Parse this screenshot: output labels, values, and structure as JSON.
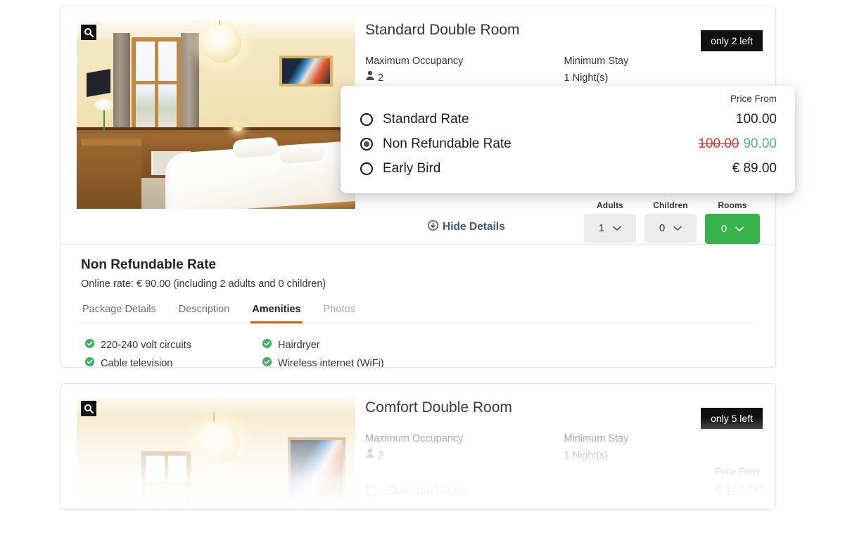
{
  "cards": [
    {
      "title": "Standard Double Room",
      "stock_badge": "only 2 left",
      "occupancy_label": "Maximum Occupancy",
      "occupancy_value": "2",
      "stay_label": "Minimum Stay",
      "stay_value": "1 Night(s)",
      "zoom_icon": "magnifier-icon",
      "hide_details": "Hide Details",
      "hide_details_icon": "circle-arrow-down-icon",
      "selectors": [
        {
          "caption": "Adults",
          "value": "1",
          "accent": false
        },
        {
          "caption": "Children",
          "value": "0",
          "accent": false
        },
        {
          "caption": "Rooms",
          "value": "0",
          "accent": true
        }
      ],
      "details": {
        "rate_name": "Non Refundable Rate",
        "rate_sub": "Online rate: € 90.00 (including 2 adults and 0 children)",
        "tabs": [
          {
            "label": "Package Details",
            "state": "normal"
          },
          {
            "label": "Description",
            "state": "normal"
          },
          {
            "label": "Amenities",
            "state": "active"
          },
          {
            "label": "Photos",
            "state": "muted"
          }
        ],
        "amenities_left": [
          "220-240 volt circuits",
          "Cable television"
        ],
        "amenities_right": [
          "Hairdryer",
          "Wireless internet (WiFi)"
        ]
      }
    },
    {
      "title": "Comfort Double Room",
      "stock_badge": "only 5 left",
      "occupancy_label": "Maximum Occupancy",
      "occupancy_value": "2",
      "stay_label": "Minimum Stay",
      "stay_value": "1 Night(s)",
      "zoom_icon": "magnifier-icon",
      "price_from_label": "Price From",
      "ghost_rate_label": "Standard Rate",
      "ghost_rate_price": "€ 110.00"
    }
  ],
  "rate_popup": {
    "price_from_label": "Price From",
    "rates": [
      {
        "label": "Standard Rate",
        "selected": false,
        "price": "100.00",
        "old_price": "",
        "discounted": ""
      },
      {
        "label": "Non Refundable Rate",
        "selected": true,
        "price": "",
        "old_price": "100.00",
        "discounted": "90.00"
      },
      {
        "label": "Early Bird",
        "selected": false,
        "price": "€ 89.00",
        "old_price": "",
        "discounted": ""
      }
    ]
  },
  "colors": {
    "accent_green": "#38b24a",
    "tab_underline_orange": "#e8590c",
    "discount_red": "#e03131",
    "discount_green": "#51b969",
    "link_blue": "#3f5a78",
    "badge_black": "#111111",
    "radio_fill": "#2e5f8a"
  }
}
